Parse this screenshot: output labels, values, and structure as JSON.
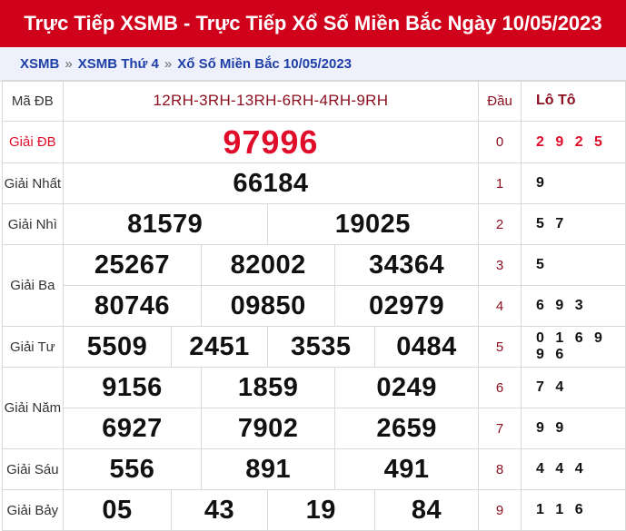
{
  "header": {
    "title": "Trực Tiếp XSMB - Trực Tiếp Xổ Số Miền Bắc Ngày 10/05/2023"
  },
  "breadcrumb": [
    "XSMB",
    "XSMB Thứ 4",
    "Xổ Số Miền Bắc 10/05/2023"
  ],
  "breadcrumb_sep": "»",
  "colors": {
    "header_bg": "#d0021b",
    "special_prize": "#e00d2a",
    "breadcrumb_link": "#1f3fa8"
  },
  "table": {
    "ma_db_label": "Mã ĐB",
    "ma_db_value": "12RH-3RH-13RH-6RH-4RH-9RH",
    "dau_header": "Đầu",
    "loto_header": "Lô Tô",
    "prizes": {
      "db": {
        "label": "Giải ĐB",
        "numbers": [
          "97996"
        ]
      },
      "nhat": {
        "label": "Giải Nhất",
        "numbers": [
          "66184"
        ]
      },
      "nhi": {
        "label": "Giải Nhì",
        "numbers": [
          "81579",
          "19025"
        ]
      },
      "ba": {
        "label": "Giải Ba",
        "numbers": [
          "25267",
          "82002",
          "34364",
          "80746",
          "09850",
          "02979"
        ]
      },
      "tu": {
        "label": "Giải Tư",
        "numbers": [
          "5509",
          "2451",
          "3535",
          "0484"
        ]
      },
      "nam": {
        "label": "Giải Năm",
        "numbers": [
          "9156",
          "1859",
          "0249",
          "6927",
          "7902",
          "2659"
        ]
      },
      "sau": {
        "label": "Giải Sáu",
        "numbers": [
          "556",
          "891",
          "491"
        ]
      },
      "bay": {
        "label": "Giải Bảy",
        "numbers": [
          "05",
          "43",
          "19",
          "84"
        ]
      }
    },
    "loto": [
      {
        "dau": "0",
        "values": "2 9 2 5"
      },
      {
        "dau": "1",
        "values": "9"
      },
      {
        "dau": "2",
        "values": "5 7"
      },
      {
        "dau": "3",
        "values": "5"
      },
      {
        "dau": "4",
        "values": "6 9 3"
      },
      {
        "dau": "5",
        "values": "0 1 6 9 9 6"
      },
      {
        "dau": "6",
        "values": "7 4"
      },
      {
        "dau": "7",
        "values": "9 9"
      },
      {
        "dau": "8",
        "values": "4 4 4"
      },
      {
        "dau": "9",
        "values": "1 1 6"
      }
    ]
  }
}
